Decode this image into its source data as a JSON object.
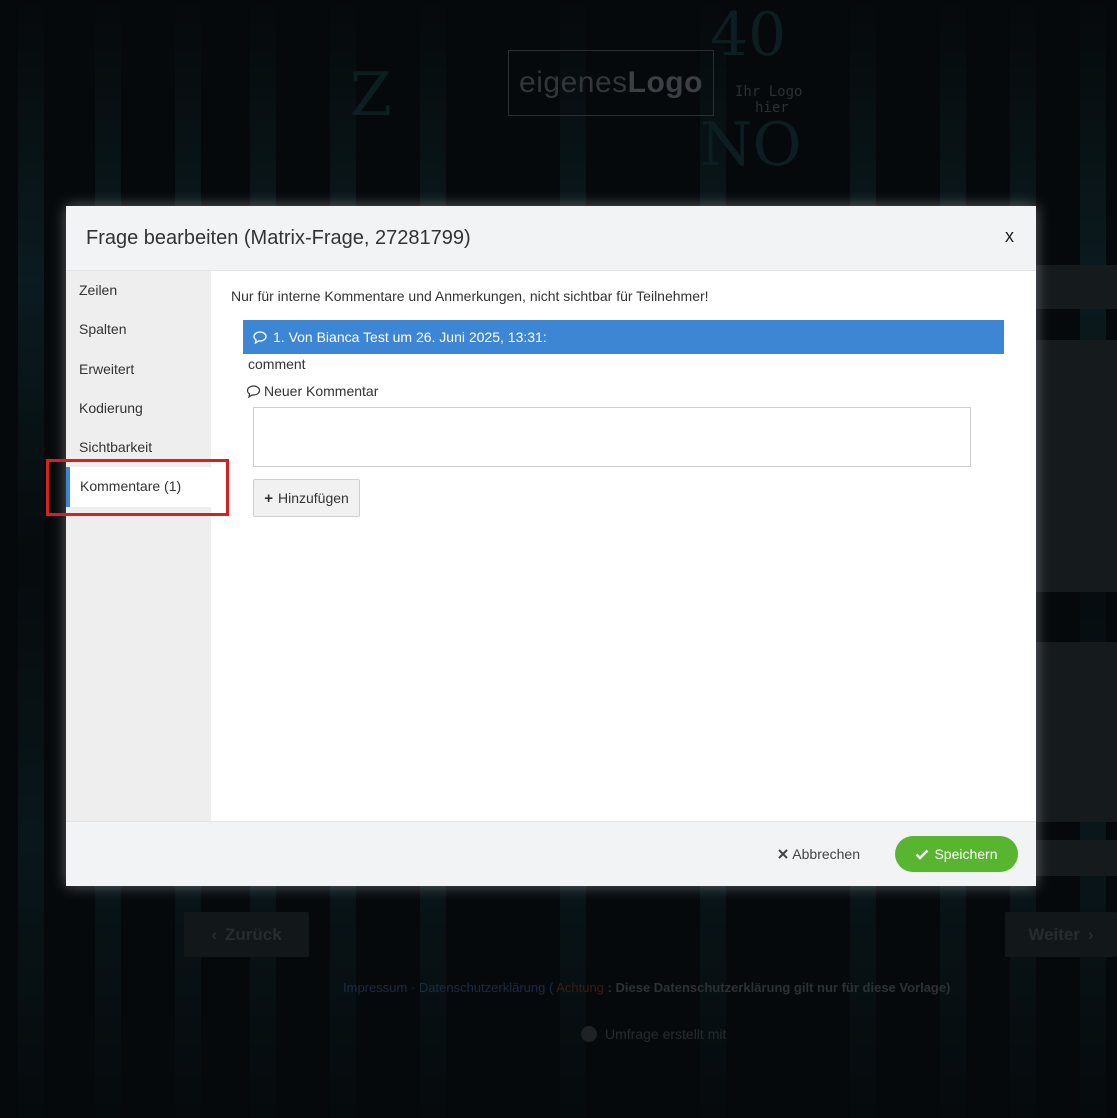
{
  "background": {
    "logo_light": "eigenes",
    "logo_bold": "Logo",
    "logo_hint_line1": "Ihr Logo",
    "logo_hint_line2": "hier",
    "back_label": "Zurück",
    "next_label": "Weiter",
    "footer": {
      "impressum": "Impressum",
      "privacy": "Datenschutzerklärung",
      "attention": "Achtung",
      "note": ": Diese Datenschutzerklärung gilt nur für diese Vorlage)",
      "made_with": "Umfrage erstellt mit"
    }
  },
  "modal": {
    "title": "Frage bearbeiten (Matrix-Frage, 27281799)",
    "close_label": "x",
    "sidebar": {
      "items": [
        {
          "label": "Zeilen"
        },
        {
          "label": "Spalten"
        },
        {
          "label": "Erweitert"
        },
        {
          "label": "Kodierung"
        },
        {
          "label": "Sichtbarkeit"
        },
        {
          "label": "Kommentare (1)",
          "active": true
        }
      ]
    },
    "content": {
      "intro": "Nur für interne Kommentare und Anmerkungen, nicht sichtbar für Teilnehmer!",
      "comments": [
        {
          "header": "1. Von Bianca Test um 26. Juni 2025, 13:31:",
          "body": "comment"
        }
      ],
      "new_comment_label": "Neuer Kommentar",
      "new_comment_value": "",
      "add_button": "Hinzufügen"
    },
    "footer": {
      "cancel_label": "Abbrechen",
      "save_label": "Speichern"
    }
  },
  "colors": {
    "accent_blue": "#3d86d4",
    "save_green": "#58b52f",
    "highlight_red": "#d92020"
  }
}
